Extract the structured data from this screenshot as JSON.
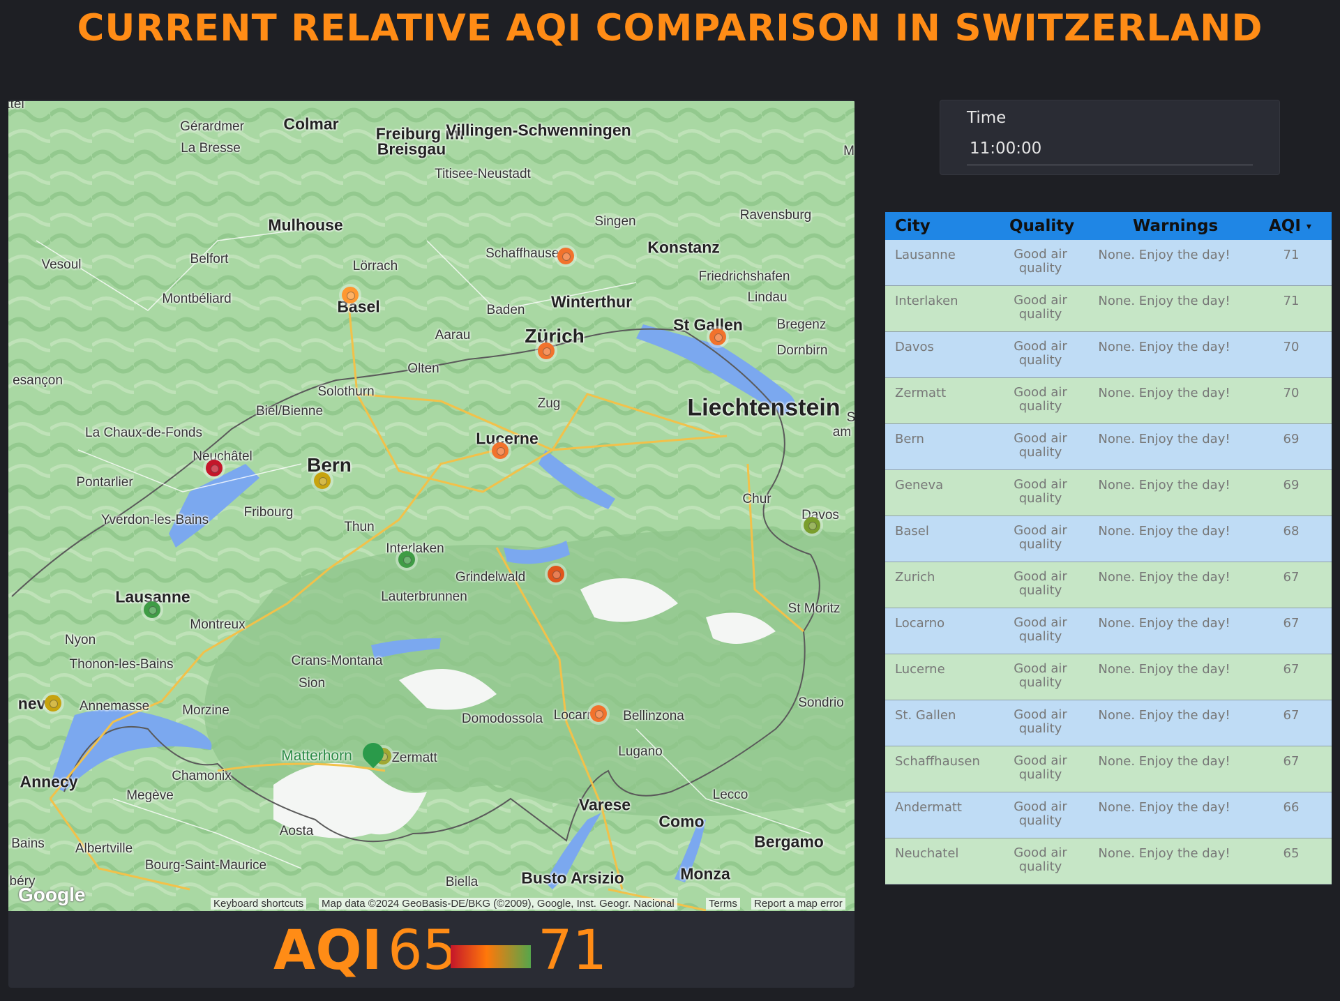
{
  "title": "CURRENT RELATIVE AQI COMPARISON IN SWITZERLAND",
  "map": {
    "places": [
      {
        "name": "Gérardmer",
        "cls": ""
      },
      {
        "name": "Colmar",
        "cls": "city"
      },
      {
        "name": "Freiburg im",
        "cls": "city"
      },
      {
        "name": "Breisgau",
        "cls": "city"
      },
      {
        "name": "Villingen-Schwenningen",
        "cls": "city"
      },
      {
        "name": "La Bresse",
        "cls": ""
      },
      {
        "name": "Titisee-Neustadt",
        "cls": ""
      },
      {
        "name": "Mulhouse",
        "cls": "city"
      },
      {
        "name": "Singen",
        "cls": ""
      },
      {
        "name": "Ravensburg",
        "cls": ""
      },
      {
        "name": "Belfort",
        "cls": ""
      },
      {
        "name": "Lörrach",
        "cls": ""
      },
      {
        "name": "Schaffhausen",
        "cls": ""
      },
      {
        "name": "Konstanz",
        "cls": "city"
      },
      {
        "name": "Vesoul",
        "cls": ""
      },
      {
        "name": "Friedrichshafen",
        "cls": ""
      },
      {
        "name": "Montbéliard",
        "cls": ""
      },
      {
        "name": "Basel",
        "cls": "city"
      },
      {
        "name": "Winterthur",
        "cls": "city"
      },
      {
        "name": "Lindau",
        "cls": ""
      },
      {
        "name": "Baden",
        "cls": ""
      },
      {
        "name": "St Gallen",
        "cls": "city"
      },
      {
        "name": "Bregenz",
        "cls": ""
      },
      {
        "name": "Zürich",
        "cls": "big"
      },
      {
        "name": "Aarau",
        "cls": ""
      },
      {
        "name": "Dornbirn",
        "cls": ""
      },
      {
        "name": "esançon",
        "cls": ""
      },
      {
        "name": "Olten",
        "cls": ""
      },
      {
        "name": "Solothurn",
        "cls": ""
      },
      {
        "name": "Zug",
        "cls": ""
      },
      {
        "name": "Liechtenstein",
        "cls": "huge"
      },
      {
        "name": "Biel/Bienne",
        "cls": ""
      },
      {
        "name": "La Chaux-de-Fonds",
        "cls": ""
      },
      {
        "name": "Lucerne",
        "cls": "city"
      },
      {
        "name": "Neuchâtel",
        "cls": ""
      },
      {
        "name": "Bern",
        "cls": "big"
      },
      {
        "name": "Pontarlier",
        "cls": ""
      },
      {
        "name": "Chur",
        "cls": ""
      },
      {
        "name": "Fribourg",
        "cls": ""
      },
      {
        "name": "Davos",
        "cls": ""
      },
      {
        "name": "Yverdon-les-Bains",
        "cls": ""
      },
      {
        "name": "Thun",
        "cls": ""
      },
      {
        "name": "Interlaken",
        "cls": ""
      },
      {
        "name": "Grindelwald",
        "cls": ""
      },
      {
        "name": "Lauterbrunnen",
        "cls": ""
      },
      {
        "name": "Lausanne",
        "cls": "city"
      },
      {
        "name": "St Moritz",
        "cls": ""
      },
      {
        "name": "Montreux",
        "cls": ""
      },
      {
        "name": "Nyon",
        "cls": ""
      },
      {
        "name": "Thonon-les-Bains",
        "cls": ""
      },
      {
        "name": "Crans-Montana",
        "cls": ""
      },
      {
        "name": "Sion",
        "cls": ""
      },
      {
        "name": "neva",
        "cls": "city"
      },
      {
        "name": "Annemasse",
        "cls": ""
      },
      {
        "name": "Morzine",
        "cls": ""
      },
      {
        "name": "Sondrio",
        "cls": ""
      },
      {
        "name": "Domodossola",
        "cls": ""
      },
      {
        "name": "Locarno",
        "cls": ""
      },
      {
        "name": "Bellinzona",
        "cls": ""
      },
      {
        "name": "Matterhorn",
        "cls": "poi"
      },
      {
        "name": "Zermatt",
        "cls": ""
      },
      {
        "name": "Lugano",
        "cls": ""
      },
      {
        "name": "Annecy",
        "cls": "city"
      },
      {
        "name": "Chamonix",
        "cls": ""
      },
      {
        "name": "Megève",
        "cls": ""
      },
      {
        "name": "Varese",
        "cls": "city"
      },
      {
        "name": "Lecco",
        "cls": ""
      },
      {
        "name": "Como",
        "cls": "city"
      },
      {
        "name": "Aosta",
        "cls": ""
      },
      {
        "name": "Bergamo",
        "cls": "city"
      },
      {
        "name": "Bains",
        "cls": ""
      },
      {
        "name": "Albertville",
        "cls": ""
      },
      {
        "name": "Bourg-Saint-Maurice",
        "cls": ""
      },
      {
        "name": "Biella",
        "cls": ""
      },
      {
        "name": "Busto Arsizio",
        "cls": "city"
      },
      {
        "name": "Monza",
        "cls": "city"
      },
      {
        "name": "ttel",
        "cls": ""
      },
      {
        "name": "M",
        "cls": ""
      },
      {
        "name": "S",
        "cls": ""
      },
      {
        "name": "am",
        "cls": ""
      },
      {
        "name": "béry",
        "cls": ""
      }
    ],
    "markers": [
      {
        "city": "Basel",
        "color": "#ff9830"
      },
      {
        "city": "Schaffhausen",
        "color": "#f2722c"
      },
      {
        "city": "Zurich",
        "color": "#f2722c"
      },
      {
        "city": "St. Gallen",
        "color": "#f2722c"
      },
      {
        "city": "Lucerne",
        "color": "#f2722c"
      },
      {
        "city": "Neuchatel",
        "color": "#c4162a"
      },
      {
        "city": "Bern",
        "color": "#c7a30f"
      },
      {
        "city": "Davos",
        "color": "#7a9e2c"
      },
      {
        "city": "Interlaken",
        "color": "#3f9c45"
      },
      {
        "city": "Andermatt",
        "color": "#e0551c"
      },
      {
        "city": "Lausanne",
        "color": "#3f9c45"
      },
      {
        "city": "Geneva",
        "color": "#c7a30f"
      },
      {
        "city": "Locarno",
        "color": "#f2722c"
      },
      {
        "city": "Zermatt",
        "color": "#a0a832"
      }
    ],
    "logo": "Google",
    "footer": {
      "shortcuts": "Keyboard shortcuts",
      "attribution": "Map data ©2024 GeoBasis-DE/BKG (©2009), Google, Inst. Geogr. Nacional",
      "terms": "Terms",
      "report": "Report a map error"
    }
  },
  "legend": {
    "label": "AQI",
    "min": "65",
    "max": "71",
    "gradient": [
      "#c4162a",
      "#ff780a",
      "#56a64b"
    ]
  },
  "time": {
    "label": "Time",
    "value": "11:00:00"
  },
  "table": {
    "headers": {
      "city": "City",
      "quality": "Quality",
      "warnings": "Warnings",
      "aqi": "AQI"
    },
    "sort_icon": "sort-desc-icon",
    "rows": [
      {
        "city": "Lausanne",
        "quality": "Good air quality",
        "warnings": "None. Enjoy the day!",
        "aqi": "71"
      },
      {
        "city": "Interlaken",
        "quality": "Good air quality",
        "warnings": "None. Enjoy the day!",
        "aqi": "71"
      },
      {
        "city": "Davos",
        "quality": "Good air quality",
        "warnings": "None. Enjoy the day!",
        "aqi": "70"
      },
      {
        "city": "Zermatt",
        "quality": "Good air quality",
        "warnings": "None. Enjoy the day!",
        "aqi": "70"
      },
      {
        "city": "Bern",
        "quality": "Good air quality",
        "warnings": "None. Enjoy the day!",
        "aqi": "69"
      },
      {
        "city": "Geneva",
        "quality": "Good air quality",
        "warnings": "None. Enjoy the day!",
        "aqi": "69"
      },
      {
        "city": "Basel",
        "quality": "Good air quality",
        "warnings": "None. Enjoy the day!",
        "aqi": "68"
      },
      {
        "city": "Zurich",
        "quality": "Good air quality",
        "warnings": "None. Enjoy the day!",
        "aqi": "67"
      },
      {
        "city": "Locarno",
        "quality": "Good air quality",
        "warnings": "None. Enjoy the day!",
        "aqi": "67"
      },
      {
        "city": "Lucerne",
        "quality": "Good air quality",
        "warnings": "None. Enjoy the day!",
        "aqi": "67"
      },
      {
        "city": "St. Gallen",
        "quality": "Good air quality",
        "warnings": "None. Enjoy the day!",
        "aqi": "67"
      },
      {
        "city": "Schaffhausen",
        "quality": "Good air quality",
        "warnings": "None. Enjoy the day!",
        "aqi": "67"
      },
      {
        "city": "Andermatt",
        "quality": "Good air quality",
        "warnings": "None. Enjoy the day!",
        "aqi": "66"
      },
      {
        "city": "Neuchatel",
        "quality": "Good air quality",
        "warnings": "None. Enjoy the day!",
        "aqi": "65"
      }
    ]
  }
}
